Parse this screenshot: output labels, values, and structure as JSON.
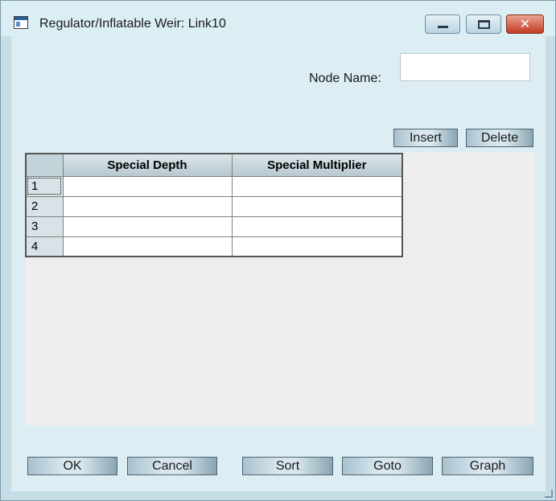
{
  "window": {
    "title": "Regulator/Inflatable Weir: Link10"
  },
  "form": {
    "node_name_label": "Node Name:",
    "node_name_value": ""
  },
  "grid_toolbar": {
    "insert_label": "Insert",
    "delete_label": "Delete"
  },
  "grid": {
    "columns": [
      "Special Depth",
      "Special Multiplier"
    ],
    "rows": [
      {
        "index": "1",
        "special_depth": "",
        "special_multiplier": ""
      },
      {
        "index": "2",
        "special_depth": "",
        "special_multiplier": ""
      },
      {
        "index": "3",
        "special_depth": "",
        "special_multiplier": ""
      },
      {
        "index": "4",
        "special_depth": "",
        "special_multiplier": ""
      }
    ]
  },
  "footer": {
    "ok_label": "OK",
    "cancel_label": "Cancel",
    "sort_label": "Sort",
    "goto_label": "Goto",
    "graph_label": "Graph"
  },
  "colors": {
    "close_button": "#c23b22",
    "window_frame": "#c6dde6"
  }
}
